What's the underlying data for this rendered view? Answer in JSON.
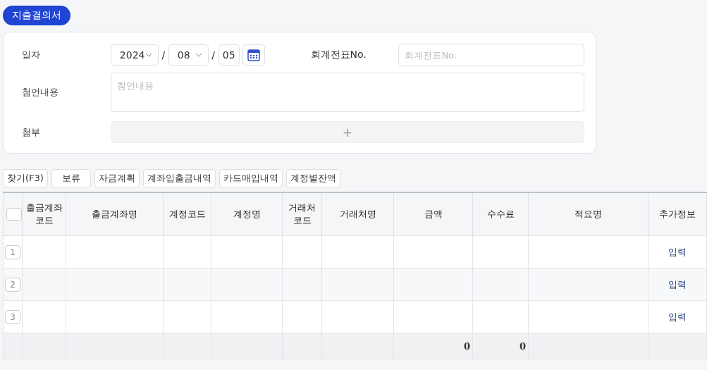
{
  "title_badge": "지출결의서",
  "form": {
    "date_label": "일자",
    "year": "2024",
    "month": "08",
    "day": "05",
    "separators": [
      "/",
      "/"
    ],
    "voucher_label": "회계전표No.",
    "voucher_placeholder": "회계전표No.",
    "comment_label": "첨언내용",
    "comment_placeholder": "첨언내용",
    "attach_label": "첨부",
    "attach_button": "+"
  },
  "toolbar": [
    "찾기(F3)",
    "보류",
    "자금계획",
    "계좌입출금내역",
    "카드매입내역",
    "계정별잔액"
  ],
  "table": {
    "select_all_checked": false,
    "columns": [
      "출금계좌 코드",
      "출금계좌명",
      "계정코드",
      "계정명",
      "거래처 코드",
      "거래처명",
      "금액",
      "수수료",
      "적요명",
      "추가정보"
    ],
    "rows": [
      {
        "number": "1",
        "action": "입력"
      },
      {
        "number": "2",
        "action": "입력"
      },
      {
        "number": "3",
        "action": "입력"
      }
    ],
    "totals": {
      "amount": "0",
      "fee": "0"
    }
  }
}
